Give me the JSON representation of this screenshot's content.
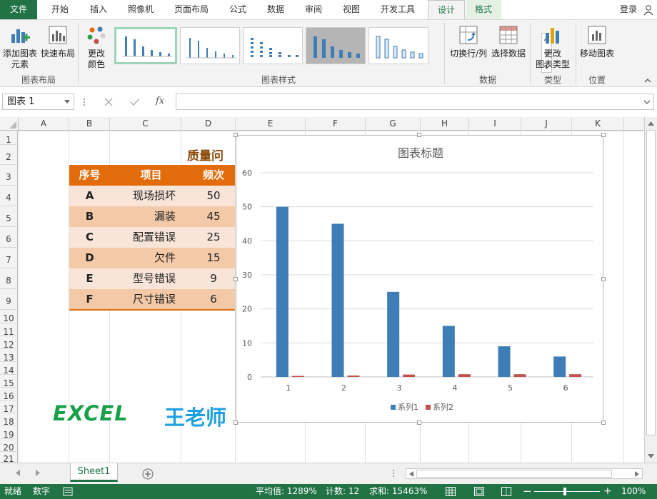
{
  "ribbon_tabs": [
    "文件",
    "开始",
    "插入",
    "照像机",
    "页面布局",
    "公式",
    "数据",
    "审阅",
    "视图",
    "开发工具",
    "设计",
    "格式"
  ],
  "login": "登录",
  "ribbon": {
    "add_element_1": "添加图表",
    "add_element_2": "元素",
    "quick_layout": "快速布局",
    "change_color_1": "更改",
    "change_color_2": "颜色",
    "group_layout": "图表布局",
    "group_styles": "图表样式",
    "switch_row_col": "切换行/列",
    "select_data": "选择数据",
    "group_data": "数据",
    "change_type_1": "更改",
    "change_type_2": "图表类型",
    "group_type": "类型",
    "move_chart": "移动图表",
    "group_location": "位置"
  },
  "formula_bar": {
    "name_box": "图表 1",
    "fx": "fx",
    "formula": ""
  },
  "columns": [
    "A",
    "B",
    "C",
    "D",
    "E",
    "F",
    "G",
    "H",
    "I",
    "J",
    "K"
  ],
  "rows": [
    "1",
    "2",
    "3",
    "4",
    "5",
    "6",
    "7",
    "8",
    "9",
    "10",
    "11",
    "12",
    "13",
    "14",
    "15",
    "16",
    "17",
    "18",
    "19",
    "20",
    "21"
  ],
  "table": {
    "title": "质量问",
    "headers": [
      "序号",
      "项目",
      "频次"
    ],
    "rows": [
      {
        "no": "A",
        "item": "现场损坏",
        "freq": "50"
      },
      {
        "no": "B",
        "item": "漏装",
        "freq": "45"
      },
      {
        "no": "C",
        "item": "配置错误",
        "freq": "25"
      },
      {
        "no": "D",
        "item": "欠件",
        "freq": "15"
      },
      {
        "no": "E",
        "item": "型号错误",
        "freq": "9"
      },
      {
        "no": "F",
        "item": "尺寸错误",
        "freq": "6"
      }
    ]
  },
  "brand": {
    "excel": "EXCEL",
    "teacher": "王老师"
  },
  "chart_data": {
    "type": "bar",
    "title": "图表标题",
    "categories": [
      "1",
      "2",
      "3",
      "4",
      "5",
      "6"
    ],
    "series": [
      {
        "name": "系列1",
        "values": [
          50,
          45,
          25,
          15,
          9,
          6
        ],
        "color": "#3e7db5"
      },
      {
        "name": "系列2",
        "values": [
          0.3,
          0.4,
          0.7,
          0.8,
          0.8,
          0.8
        ],
        "color": "#c0504d"
      }
    ],
    "ylim": [
      0,
      60
    ],
    "yticks": [
      0,
      10,
      20,
      30,
      40,
      50,
      60
    ],
    "grid": true,
    "legend": "bottom"
  },
  "sheet_tab": "Sheet1",
  "status": {
    "ready": "就绪",
    "mode": "数字",
    "average": "平均值: 1289%",
    "count": "计数: 12",
    "sum": "求和: 15463%",
    "zoom": "100%"
  },
  "colors": {
    "excel_green": "#217346",
    "header_orange": "#e26b0a",
    "row_light": "#f8e4d8",
    "row_dark": "#f4c9a8",
    "bar_blue": "#3e7db5",
    "bar_red": "#c0504d"
  }
}
